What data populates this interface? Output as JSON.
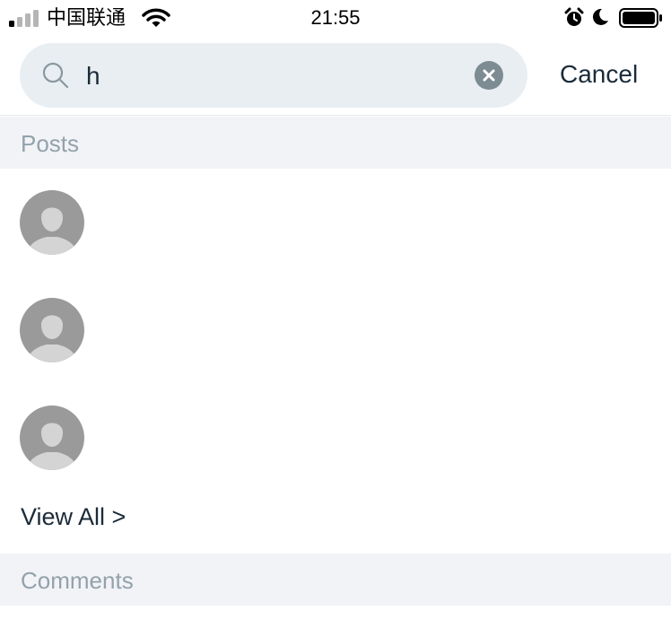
{
  "status_bar": {
    "carrier": "中国联通",
    "time": "21:55"
  },
  "search": {
    "query": "h",
    "cancel_label": "Cancel"
  },
  "sections": {
    "posts": {
      "title": "Posts",
      "view_all_label": "View All >"
    },
    "comments": {
      "title": "Comments"
    }
  },
  "icons": {
    "search": "search-icon",
    "clear": "clear-icon",
    "avatar": "default-avatar-icon"
  },
  "colors": {
    "search_bg": "#e8eef1",
    "section_bg": "#f2f3f7",
    "section_text": "#93a2ab",
    "text_primary": "#1b2b3a",
    "avatar_bg": "#9a9a9a",
    "avatar_figure": "#d4d4d4"
  }
}
